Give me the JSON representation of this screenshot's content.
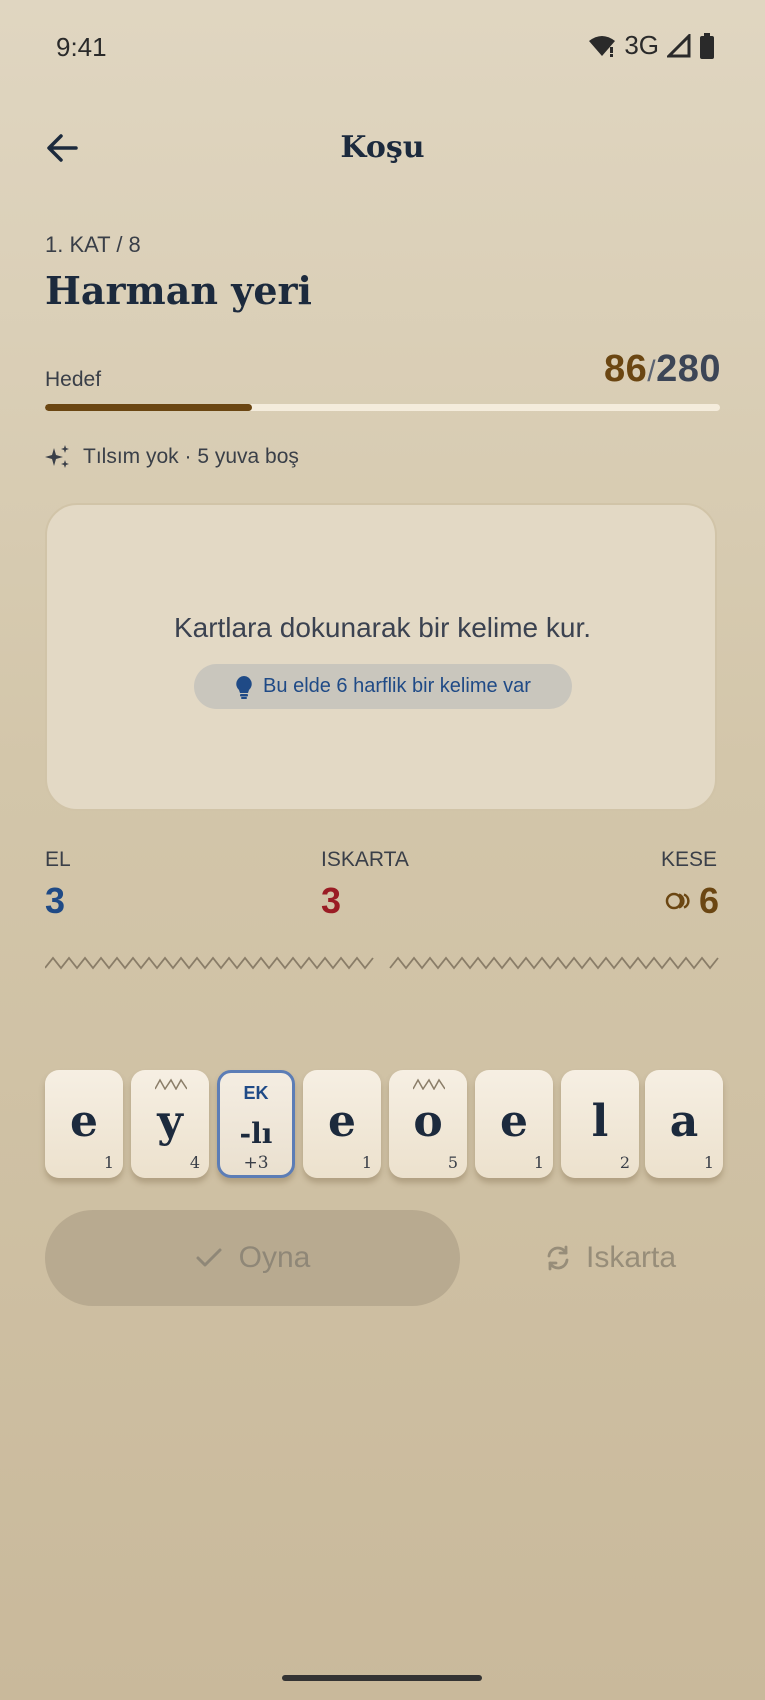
{
  "status_bar": {
    "time": "9:41",
    "network": "3G"
  },
  "header": {
    "title": "Koşu",
    "back_icon": "arrow-left-icon"
  },
  "floor": {
    "label": "1. KAT / 8",
    "name": "Harman yeri"
  },
  "goal": {
    "label": "Hedef",
    "current": "86",
    "separator": "/",
    "target": "280",
    "progress": 0.307
  },
  "charms": {
    "text": "Tılsım yok · 5 yuva boş",
    "icon": "sparkles-icon"
  },
  "word_area": {
    "prompt": "Kartlara dokunarak bir kelime kur.",
    "hint": "Bu elde 6 harflik bir kelime var",
    "hint_icon": "lightbulb-icon"
  },
  "stats": {
    "hands": {
      "label": "EL",
      "value": "3"
    },
    "discards": {
      "label": "ISKARTA",
      "value": "3"
    },
    "purse": {
      "label": "KESE",
      "value": "6",
      "icon": "coin-icon"
    }
  },
  "tiles": [
    {
      "letter": "e",
      "points": "1",
      "wave": false
    },
    {
      "letter": "y",
      "points": "4",
      "wave": true
    },
    {
      "type": "suffix",
      "tag": "EK",
      "text": "-lı",
      "bonus": "+3"
    },
    {
      "letter": "e",
      "points": "1",
      "wave": false
    },
    {
      "letter": "o",
      "points": "5",
      "wave": true
    },
    {
      "letter": "e",
      "points": "1",
      "wave": false
    },
    {
      "letter": "l",
      "points": "2",
      "wave": false
    },
    {
      "letter": "a",
      "points": "1",
      "wave": false
    }
  ],
  "actions": {
    "play": "Oyna",
    "discard": "Iskarta"
  },
  "colors": {
    "accent_brown": "#6b4612",
    "accent_blue": "#1f4a86",
    "accent_red": "#9a1c24",
    "text_dark": "#1c2a3d"
  }
}
